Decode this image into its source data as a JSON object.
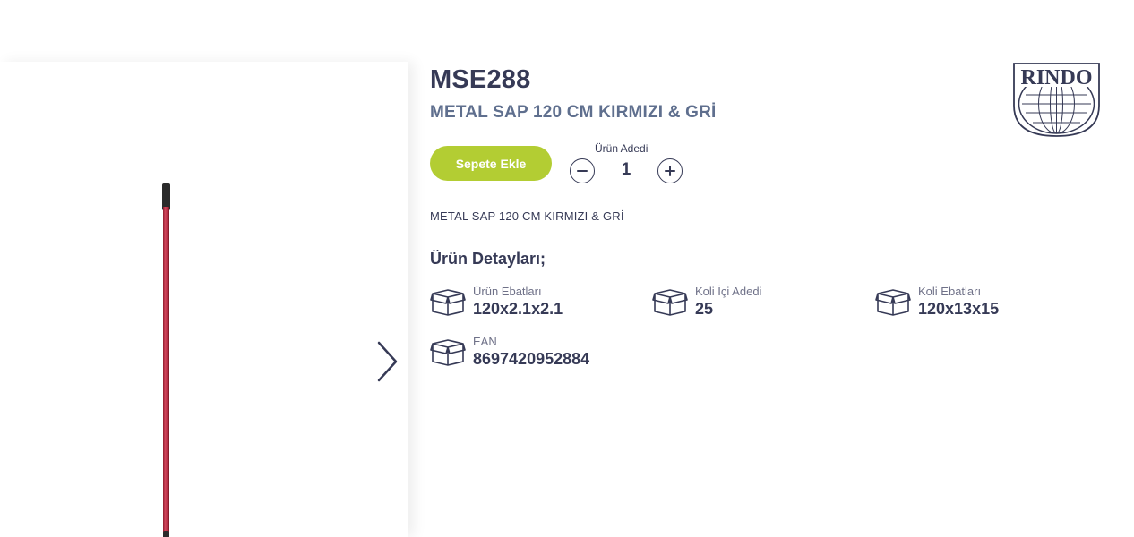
{
  "product": {
    "sku": "MSE288",
    "name": "METAL SAP 120 CM KIRMIZI & GRİ",
    "description": "METAL SAP 120 CM KIRMIZI & GRİ"
  },
  "brand": {
    "logo_text": "RINDO"
  },
  "cart": {
    "add_label": "Sepete Ekle",
    "quantity_label": "Ürün Adedi",
    "quantity": "1"
  },
  "details": {
    "title": "Ürün Detayları;",
    "items": [
      {
        "label": "Ürün Ebatları",
        "value": "120x2.1x2.1",
        "icon": "box-icon"
      },
      {
        "label": "Koli İçi Adedi",
        "value": "25",
        "icon": "box-icon"
      },
      {
        "label": "Koli Ebatları",
        "value": "120x13x15",
        "icon": "box-icon"
      },
      {
        "label": "EAN",
        "value": "8697420952884",
        "icon": "box-icon"
      }
    ]
  },
  "gallery": {
    "next_icon": "chevron-right-icon"
  },
  "colors": {
    "accent": "#b3cd33",
    "text_dark": "#363a56",
    "text_muted": "#5f6f8e",
    "product_red": "#c0334a"
  }
}
